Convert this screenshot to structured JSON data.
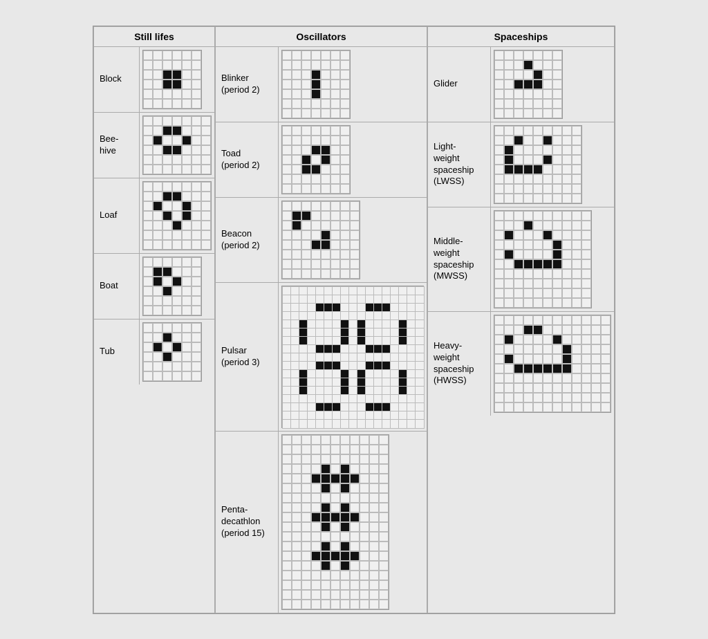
{
  "sections": {
    "still_lifes": {
      "title": "Still lifes",
      "patterns": [
        {
          "name": "Block",
          "cols": 6,
          "rows": 6,
          "alive": [
            [
              2,
              2
            ],
            [
              2,
              3
            ],
            [
              3,
              2
            ],
            [
              3,
              3
            ]
          ]
        },
        {
          "name": "Bee-\nhive",
          "cols": 7,
          "rows": 6,
          "alive": [
            [
              1,
              2
            ],
            [
              1,
              3
            ],
            [
              2,
              1
            ],
            [
              2,
              4
            ],
            [
              3,
              2
            ],
            [
              3,
              3
            ]
          ]
        },
        {
          "name": "Loaf",
          "cols": 7,
          "rows": 7,
          "alive": [
            [
              1,
              2
            ],
            [
              1,
              3
            ],
            [
              2,
              1
            ],
            [
              2,
              4
            ],
            [
              3,
              4
            ],
            [
              3,
              2
            ],
            [
              4,
              3
            ]
          ]
        },
        {
          "name": "Boat",
          "cols": 6,
          "rows": 6,
          "alive": [
            [
              1,
              1
            ],
            [
              1,
              2
            ],
            [
              2,
              1
            ],
            [
              2,
              3
            ],
            [
              3,
              2
            ]
          ]
        },
        {
          "name": "Tub",
          "cols": 6,
          "rows": 6,
          "alive": [
            [
              1,
              2
            ],
            [
              2,
              1
            ],
            [
              2,
              3
            ],
            [
              3,
              2
            ]
          ]
        }
      ]
    },
    "oscillators": {
      "title": "Oscillators",
      "patterns": [
        {
          "name": "Blinker\n(period 2)",
          "cols": 7,
          "rows": 7,
          "alive": [
            [
              2,
              3
            ],
            [
              3,
              3
            ],
            [
              4,
              3
            ]
          ]
        },
        {
          "name": "Toad\n(period 2)",
          "cols": 7,
          "rows": 7,
          "alive": [
            [
              2,
              3
            ],
            [
              2,
              4
            ],
            [
              3,
              2
            ],
            [
              3,
              4
            ],
            [
              4,
              2
            ],
            [
              4,
              3
            ]
          ]
        },
        {
          "name": "Beacon\n(period 2)",
          "cols": 8,
          "rows": 8,
          "alive": [
            [
              1,
              1
            ],
            [
              1,
              2
            ],
            [
              2,
              1
            ],
            [
              3,
              4
            ],
            [
              4,
              3
            ],
            [
              4,
              4
            ]
          ]
        },
        {
          "name": "Pulsar\n(period 3)",
          "cols": 17,
          "rows": 17,
          "alive": [
            [
              2,
              4
            ],
            [
              2,
              5
            ],
            [
              2,
              6
            ],
            [
              2,
              10
            ],
            [
              2,
              11
            ],
            [
              2,
              12
            ],
            [
              4,
              2
            ],
            [
              4,
              7
            ],
            [
              4,
              9
            ],
            [
              4,
              14
            ],
            [
              5,
              2
            ],
            [
              5,
              7
            ],
            [
              5,
              9
            ],
            [
              5,
              14
            ],
            [
              6,
              2
            ],
            [
              6,
              7
            ],
            [
              6,
              9
            ],
            [
              6,
              14
            ],
            [
              7,
              4
            ],
            [
              7,
              5
            ],
            [
              7,
              6
            ],
            [
              7,
              10
            ],
            [
              7,
              11
            ],
            [
              7,
              12
            ],
            [
              9,
              4
            ],
            [
              9,
              5
            ],
            [
              9,
              6
            ],
            [
              9,
              10
            ],
            [
              9,
              11
            ],
            [
              9,
              12
            ],
            [
              10,
              2
            ],
            [
              10,
              7
            ],
            [
              10,
              9
            ],
            [
              10,
              14
            ],
            [
              11,
              2
            ],
            [
              11,
              7
            ],
            [
              11,
              9
            ],
            [
              11,
              14
            ],
            [
              12,
              2
            ],
            [
              12,
              7
            ],
            [
              12,
              9
            ],
            [
              12,
              14
            ],
            [
              14,
              4
            ],
            [
              14,
              5
            ],
            [
              14,
              6
            ],
            [
              14,
              10
            ],
            [
              14,
              11
            ],
            [
              14,
              12
            ]
          ]
        },
        {
          "name": "Penta-\ndecathlon\n(period 15)",
          "cols": 11,
          "rows": 18,
          "alive": [
            [
              3,
              4
            ],
            [
              3,
              6
            ],
            [
              4,
              3
            ],
            [
              4,
              4
            ],
            [
              4,
              5
            ],
            [
              4,
              6
            ],
            [
              4,
              7
            ],
            [
              5,
              4
            ],
            [
              5,
              6
            ],
            [
              7,
              4
            ],
            [
              7,
              6
            ],
            [
              8,
              3
            ],
            [
              8,
              4
            ],
            [
              8,
              5
            ],
            [
              8,
              6
            ],
            [
              8,
              7
            ],
            [
              9,
              4
            ],
            [
              9,
              6
            ],
            [
              11,
              4
            ],
            [
              11,
              6
            ],
            [
              12,
              3
            ],
            [
              12,
              4
            ],
            [
              12,
              5
            ],
            [
              12,
              6
            ],
            [
              12,
              7
            ],
            [
              13,
              4
            ],
            [
              13,
              6
            ]
          ]
        }
      ]
    },
    "spaceships": {
      "title": "Spaceships",
      "patterns": [
        {
          "name": "Glider",
          "cols": 7,
          "rows": 7,
          "alive": [
            [
              1,
              3
            ],
            [
              2,
              4
            ],
            [
              3,
              2
            ],
            [
              3,
              3
            ],
            [
              3,
              4
            ]
          ]
        },
        {
          "name": "Light-\nweight\nspaceship\n(LWSS)",
          "cols": 9,
          "rows": 8,
          "alive": [
            [
              1,
              2
            ],
            [
              1,
              5
            ],
            [
              2,
              1
            ],
            [
              3,
              1
            ],
            [
              3,
              5
            ],
            [
              4,
              1
            ],
            [
              4,
              2
            ],
            [
              4,
              3
            ],
            [
              4,
              4
            ]
          ]
        },
        {
          "name": "Middle-\nweight\nspaceship\n(MWSS)",
          "cols": 10,
          "rows": 10,
          "alive": [
            [
              1,
              3
            ],
            [
              2,
              1
            ],
            [
              2,
              5
            ],
            [
              3,
              6
            ],
            [
              4,
              1
            ],
            [
              4,
              6
            ],
            [
              5,
              2
            ],
            [
              5,
              3
            ],
            [
              5,
              4
            ],
            [
              5,
              5
            ],
            [
              5,
              6
            ]
          ]
        },
        {
          "name": "Heavy-\nweight\nspaceship\n(HWSS)",
          "cols": 12,
          "rows": 10,
          "alive": [
            [
              1,
              3
            ],
            [
              1,
              4
            ],
            [
              2,
              1
            ],
            [
              2,
              6
            ],
            [
              3,
              7
            ],
            [
              4,
              1
            ],
            [
              4,
              7
            ],
            [
              5,
              2
            ],
            [
              5,
              3
            ],
            [
              5,
              4
            ],
            [
              5,
              5
            ],
            [
              5,
              6
            ],
            [
              5,
              7
            ]
          ]
        }
      ]
    }
  }
}
